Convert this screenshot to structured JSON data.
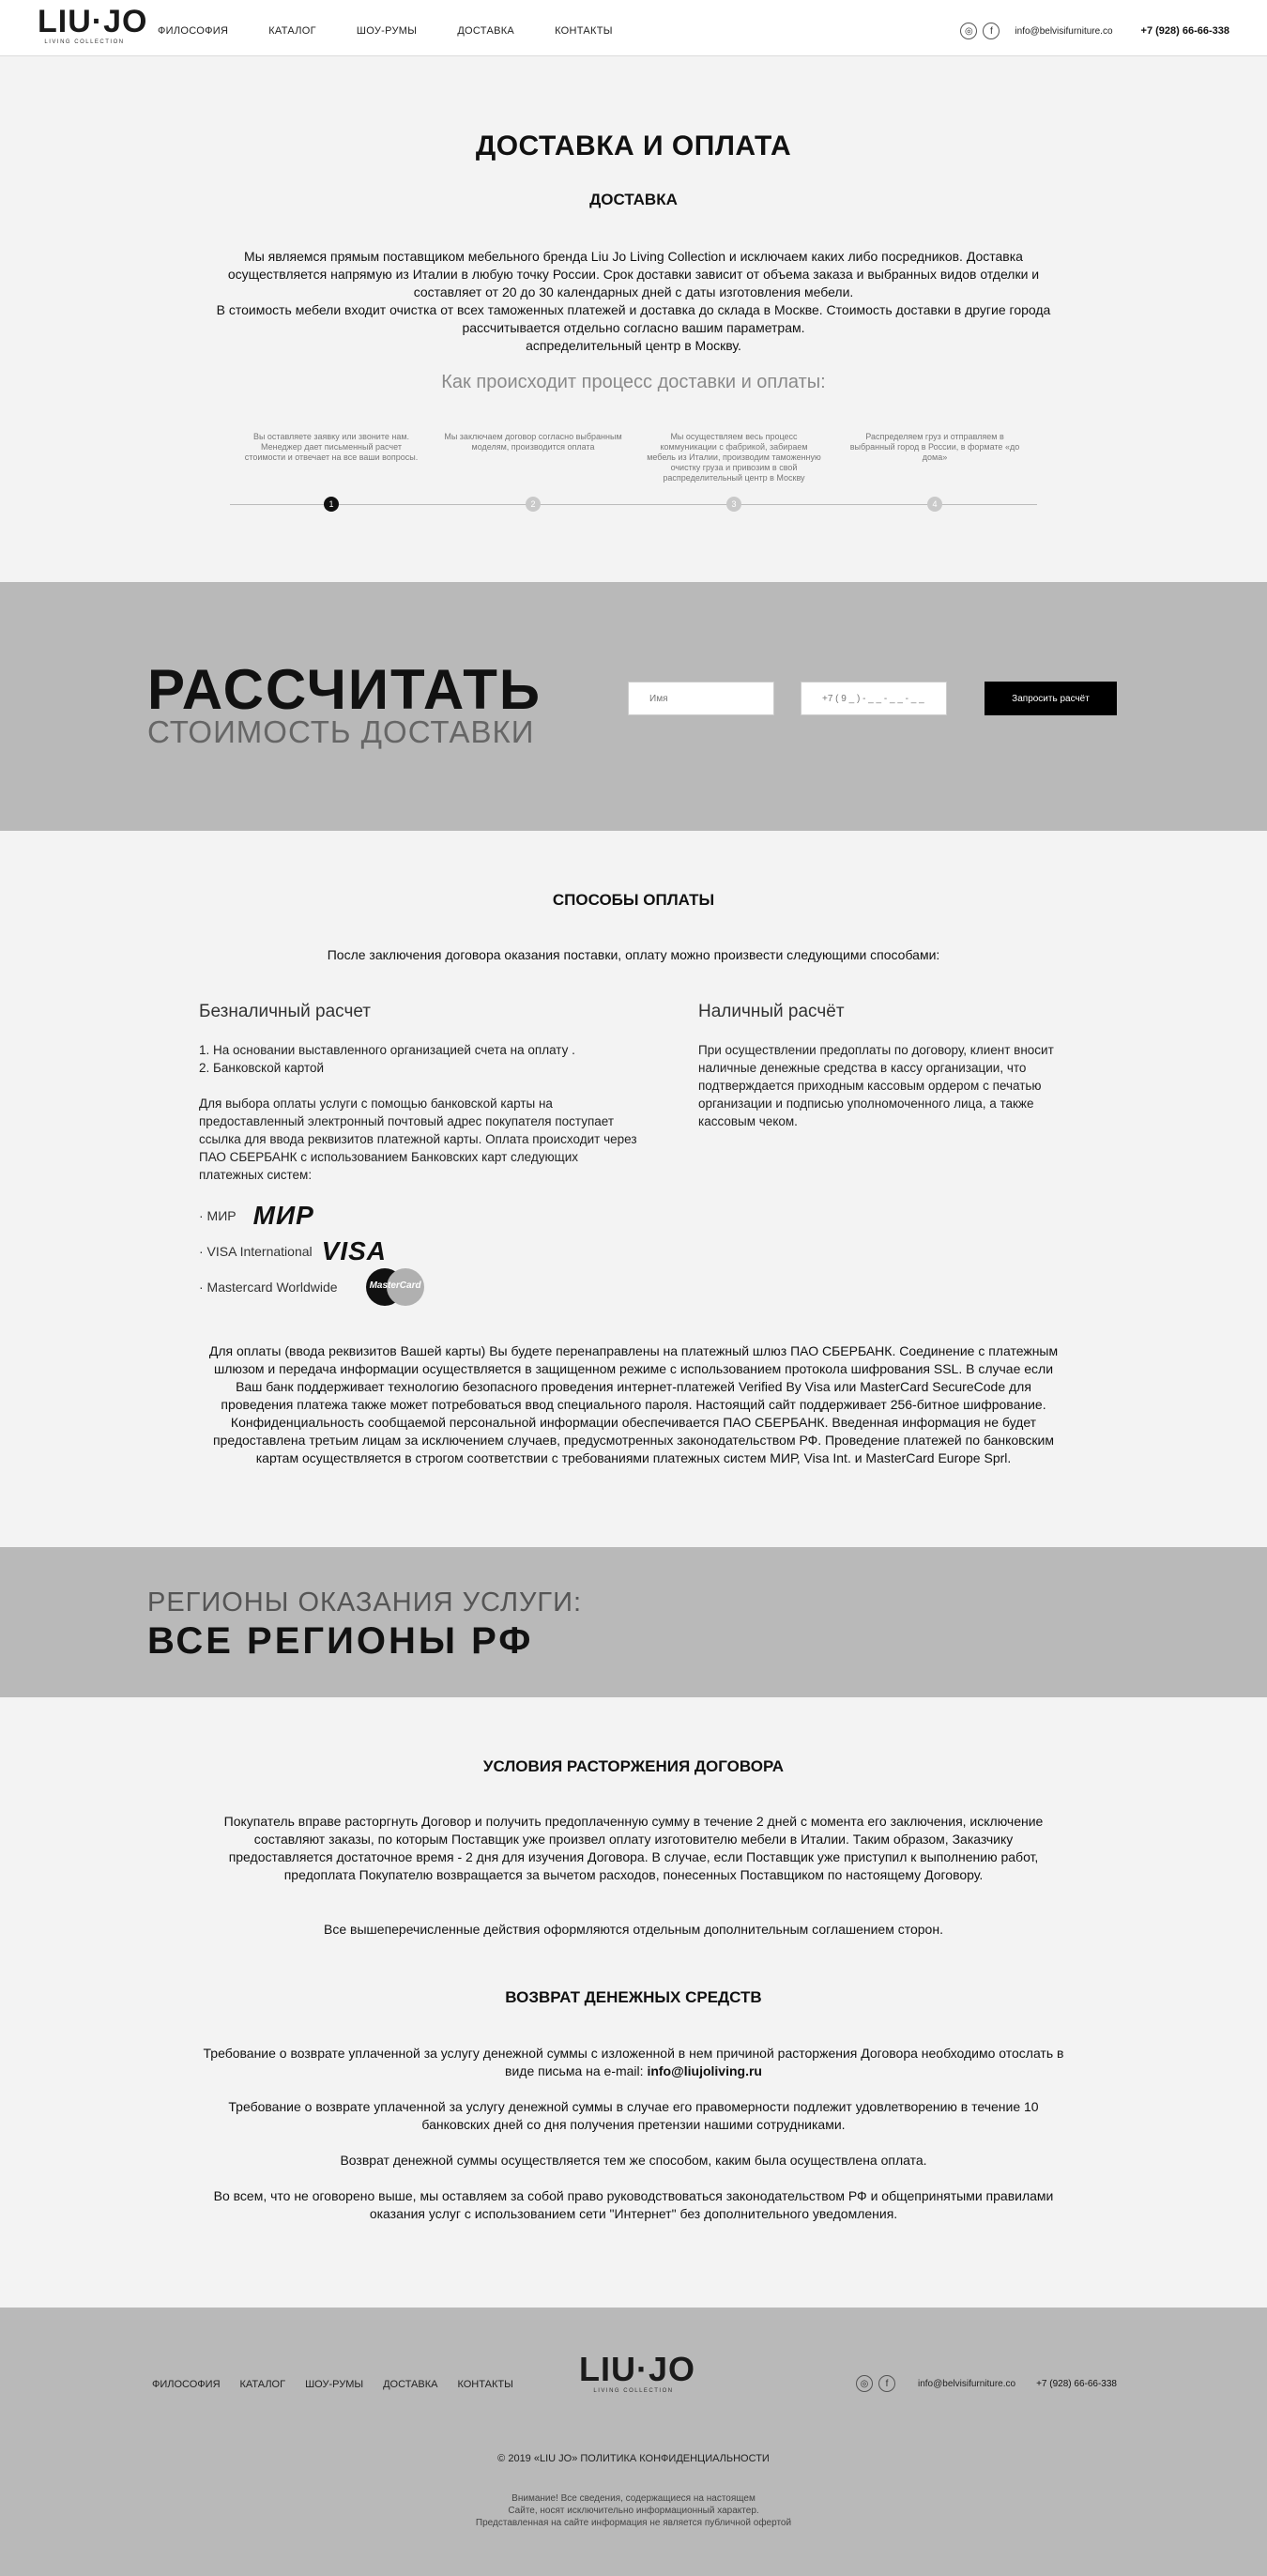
{
  "header": {
    "logo": "LIU·JO",
    "logo_sub": "LIVING COLLECTION",
    "nav": [
      "ФИЛОСОФИЯ",
      "КАТАЛОГ",
      "ШОУ-РУМЫ",
      "ДОСТАВКА",
      "КОНТАКТЫ"
    ],
    "email": "info@belvisifurniture.co",
    "phone": "+7 (928) 66-66-338",
    "icons": [
      "instagram-icon",
      "facebook-icon"
    ]
  },
  "delivery": {
    "title": "ДОСТАВКА И ОПЛАТА",
    "subtitle": "ДОСТАВКА",
    "p1": "Мы являемся прямым поставщиком мебельного бренда Liu Jo Living Collection и исключаем каких либо посредников. Доставка осуществляется напрямую из Италии в любую точку России. Срок доставки зависит от объема заказа и выбранных видов отделки и составляет от 20 до 30 календарных дней с даты изготовления мебели.",
    "p2": "В стоимость мебели входит очистка от всех таможенных платежей и доставка до склада в Москве. Стоимость доставки в другие города рассчитывается отдельно согласно вашим параметрам.",
    "p3": "аспределительный центр в Москву.",
    "process_title": "Как происходит процесс доставки и оплаты:",
    "steps": [
      {
        "num": "1",
        "text": "Вы оставляете заявку или звоните нам. Менеджер дает письменный расчет стоимости и отвечает на все ваши вопросы."
      },
      {
        "num": "2",
        "text": "Мы заключаем договор согласно выбранным моделям, производится оплата"
      },
      {
        "num": "3",
        "text": "Мы осуществляем весь процесс коммуникации с фабрикой, забираем мебель из Италии, производим таможенную очистку груза и привозим в свой распределительный центр в Москву"
      },
      {
        "num": "4",
        "text": "Распределяем груз и отправляем в выбранный город в России, в формате «до дома»"
      }
    ]
  },
  "calc": {
    "big": "РАССЧИТАТЬ",
    "small": "СТОИМОСТЬ ДОСТАВКИ",
    "name_placeholder": "Имя",
    "phone_placeholder": "+7 ( 9 _ ) - _ _ - _ _ - _ _",
    "button": "Запросить расчёт"
  },
  "payment": {
    "title": "СПОСОБЫ ОПЛАТЫ",
    "intro": "После заключения договора оказания поставки, оплату можно произвести следующими способами:",
    "cashless_title": "Безналичный расчет",
    "cashless_l1": "1. На основании выставленного организацией счета на оплату .",
    "cashless_l2": "2. Банковской картой",
    "cashless_text": "Для выбора оплаты услуги с помощью банковской карты на предоставленный электронный почтовый адрес покупателя поступает ссылка для ввода реквизитов платежной карты. Оплата происходит через ПАО СБЕРБАНК с использованием Банковских карт следующих платежных систем:",
    "cash_title": "Наличный расчёт",
    "cash_text": "При осуществлении предоплаты по договору, клиент вносит наличные денежные средства в кассу организации, что подтверждается приходным кассовым ордером с печатью организации и подписью уполномоченного лица, а также кассовым чеком.",
    "systems": [
      "· МИР",
      "· VISA International",
      "· Mastercard Worldwide"
    ],
    "mir_logo": "МИР",
    "visa_logo": "VISA",
    "mc_logo": "MasterCard",
    "footer_text": "Для оплаты (ввода реквизитов Вашей карты) Вы будете перенаправлены на платежный шлюз ПАО СБЕРБАНК. Соединение с платежным шлюзом и передача информации осуществляется в защищенном режиме с использованием протокола шифрования SSL. В случае если Ваш банк поддерживает технологию безопасного проведения интернет-платежей Verified By Visa или MasterCard SecureCode для проведения платежа также может потребоваться ввод специального пароля. Настоящий сайт поддерживает 256-битное шифрование. Конфиденциальность сообщаемой персональной информации обеспечивается ПАО СБЕРБАНК. Введенная информация не будет предоставлена третьим лицам за исключением случаев, предусмотренных законодательством РФ. Проведение платежей по банковским картам осуществляется в строгом соответствии с требованиями платежных систем МИР, Visa Int. и MasterCard Europe Sprl."
  },
  "regions": {
    "small": "РЕГИОНЫ ОКАЗАНИЯ УСЛУГИ:",
    "big": "ВСЕ РЕГИОНЫ РФ"
  },
  "terms": {
    "title": "УСЛОВИЯ РАСТОРЖЕНИЯ ДОГОВОРА",
    "p1": "Покупатель вправе расторгнуть Договор и получить предоплаченную сумму в течение 2 дней с момента его заключения, исключение составляют заказы, по которым Поставщик уже произвел оплату изготовителю мебели в Италии. Таким образом, Заказчику предоставляется достаточное время - 2 дня для изучения Договора. В случае, если Поставщик уже приступил к выполнению работ, предоплата Покупателю возвращается за вычетом расходов, понесенных Поставщиком по настоящему Договору.",
    "p2": "Все вышеперечисленные действия оформляются отдельным дополнительным соглашением сторон."
  },
  "refund": {
    "title": "ВОЗВРАТ ДЕНЕЖНЫХ СРЕДСТВ",
    "p1": "Требование о возврате уплаченной за услугу денежной суммы с изложенной в нем причиной расторжения Договора необходимо отослать в виде письма на e-mail:",
    "email": "info@liujoliving.ru",
    "p2": "Требование о возврате уплаченной за услугу денежной суммы в случае его правомерности подлежит удовлетворению в течение 10 банковских дней со дня получения претензии нашими сотрудниками.",
    "p3": "Возврат денежной суммы осуществляется тем же способом, каким была осуществлена оплата.",
    "p4": "Во всем, что не оговорено выше, мы оставляем за собой право руководствоваться законодательством РФ и общепринятыми правилами оказания услуг с использованием сети \"Интернет\" без дополнительного уведомления."
  },
  "footer": {
    "nav": [
      "ФИЛОСОФИЯ",
      "КАТАЛОГ",
      "ШОУ-РУМЫ",
      "ДОСТАВКА",
      "КОНТАКТЫ"
    ],
    "logo": "LIU·JO",
    "logo_sub": "LIVING COLLECTION",
    "email": "info@belvisifurniture.co",
    "phone": "+7 (928) 66-66-338",
    "copyright": "© 2019 «LIU JO» ПОЛИТИКА КОНФИДЕНЦИАЛЬНОСТИ",
    "note1": "Внимание! Все сведения, содержащиеся на настоящем",
    "note2": "Сайте, носят исключительно информационный характер.",
    "note3": "Представленная на сайте информация не является публичной офертой"
  }
}
